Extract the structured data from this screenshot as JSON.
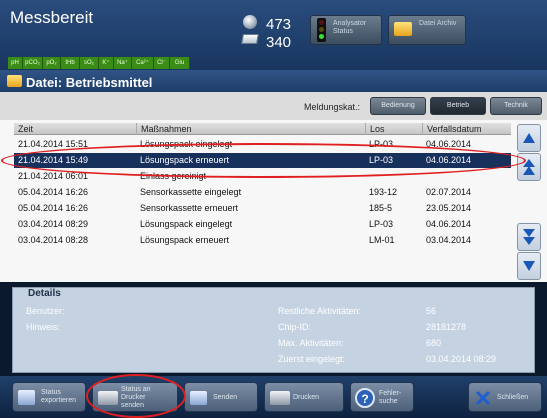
{
  "header": {
    "title": "Messbereit",
    "count_top": "473",
    "count_bottom": "340",
    "btn_analysator": "Analysator Status",
    "btn_archiv": "Datei Archiv",
    "params": [
      "pH",
      "pCO₂",
      "pO₂",
      "tHb",
      "sO₂",
      "K⁺",
      "Na⁺",
      "Ca²⁺",
      "Cl⁻",
      "Glu"
    ]
  },
  "file": {
    "title": "Datei: Betriebsmittel"
  },
  "filter": {
    "label": "Meldungskat.:",
    "buttons": [
      "Bedienung",
      "Betrieb",
      "Technik"
    ],
    "active": "Betrieb"
  },
  "table": {
    "columns": [
      "Zeit",
      "Maßnahmen",
      "Los",
      "Verfallsdatum"
    ],
    "rows": [
      [
        "21.04.2014 15:51",
        "Lösungspack eingelegt",
        "LP-03",
        "04.06.2014"
      ],
      [
        "21.04.2014 15:49",
        "Lösungspack erneuert",
        "LP-03",
        "04.06.2014"
      ],
      [
        "21.04.2014 06:01",
        "Einlass gereinigt",
        "",
        ""
      ],
      [
        "05.04.2014 16:26",
        "Sensorkassette eingelegt",
        "193-12",
        "02.07.2014"
      ],
      [
        "05.04.2014 16:26",
        "Sensorkassette erneuert",
        "185-5",
        "23.05.2014"
      ],
      [
        "03.04.2014 08:29",
        "Lösungspack eingelegt",
        "LP-03",
        "04.06.2014"
      ],
      [
        "03.04.2014 08:28",
        "Lösungspack erneuert",
        "LM-01",
        "03.04.2014"
      ]
    ],
    "selected_index": 1
  },
  "details": {
    "title": "Details",
    "benutzer_label": "Benutzer:",
    "hinweis_label": "Hinweis:",
    "restliche_label": "Restliche Aktivitäten:",
    "restliche_value": "56",
    "chip_label": "Chip-ID:",
    "chip_value": "28181278",
    "max_label": "Max. Aktivitäten:",
    "max_value": "680",
    "zuerst_label": "Zuerst eingelegt:",
    "zuerst_value": "03.04.2014 08:29"
  },
  "bottom": {
    "status_export": "Status exportieren",
    "status_drucker": "Status an Drucker senden",
    "senden": "Senden",
    "drucken": "Drucken",
    "fehlersuche": "Fehler-suche",
    "schliessen": "Schließen"
  },
  "colors": {
    "header_bg": "#1f3f6d",
    "status_green": "#3a8c17",
    "selection": "#17305c",
    "annotation_red": "#e02020"
  }
}
